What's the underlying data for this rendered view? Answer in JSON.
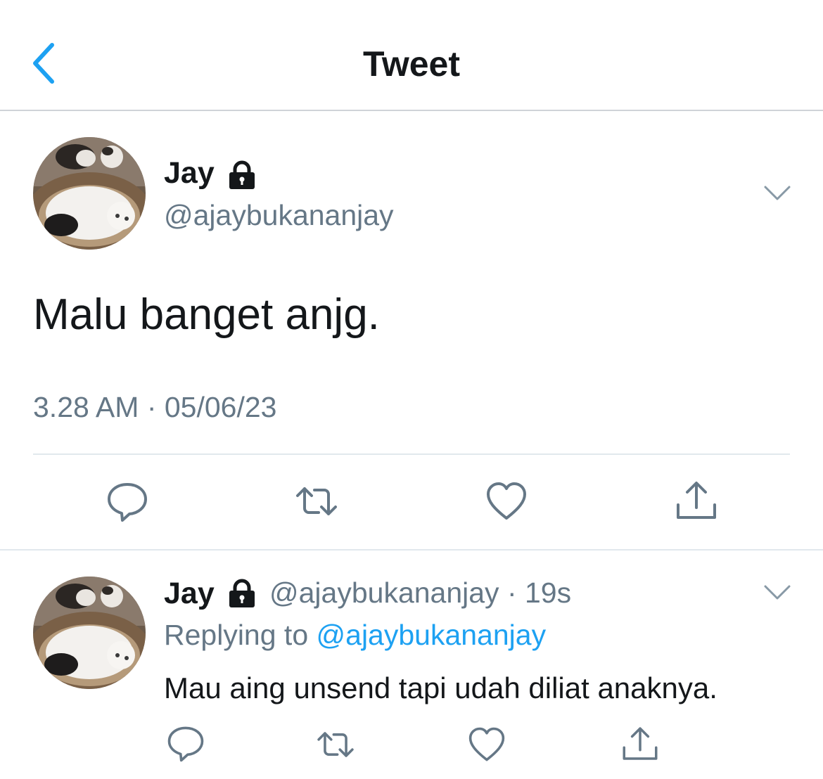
{
  "header": {
    "title": "Tweet",
    "back_icon": "chevron-left-icon",
    "accent_color": "#1da1f2"
  },
  "main_tweet": {
    "author_name": "Jay",
    "protected_icon": "lock-icon",
    "handle": "@ajaybukananjay",
    "text": "Malu banget anjg.",
    "timestamp": "3.28 AM · 05/06/23",
    "menu_icon": "chevron-down-icon",
    "actions": [
      {
        "name": "reply",
        "icon": "comment-icon"
      },
      {
        "name": "retweet",
        "icon": "retweet-icon"
      },
      {
        "name": "like",
        "icon": "heart-icon"
      },
      {
        "name": "share",
        "icon": "share-icon"
      }
    ]
  },
  "reply_tweet": {
    "author_name": "Jay",
    "protected_icon": "lock-icon",
    "handle": "@ajaybukananjay",
    "separator": " · ",
    "time_ago": "19s",
    "replying_prefix": "Replying to ",
    "replying_to": "@ajaybukananjay",
    "text": "Mau aing unsend tapi udah diliat anaknya.",
    "menu_icon": "chevron-down-icon",
    "actions": [
      {
        "name": "reply",
        "icon": "comment-icon"
      },
      {
        "name": "retweet",
        "icon": "retweet-icon"
      },
      {
        "name": "like",
        "icon": "heart-icon"
      },
      {
        "name": "share",
        "icon": "share-icon"
      }
    ]
  }
}
